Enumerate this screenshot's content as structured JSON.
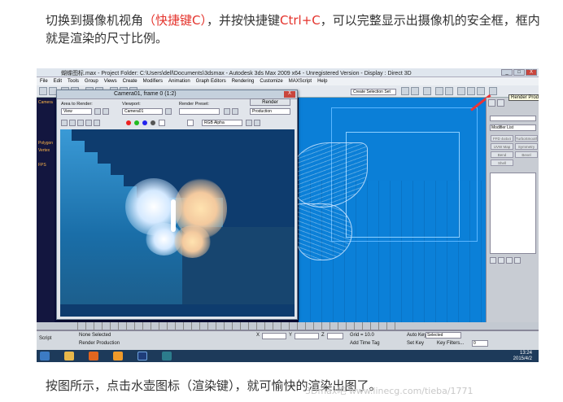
{
  "caption_top": {
    "part1": "切换到摄像机视角",
    "highlight1": "（快捷键C）",
    "part2": "，并按快捷键",
    "highlight2": "Ctrl+C",
    "part3": "，可以完整显示出摄像机的安全框，框内就是渲染的尺寸比例。"
  },
  "caption_bottom": "按图所示，点击水壶图标（渲染键），就可愉快的渲染出图了。",
  "watermark": "3Dmax吧 www.linecg.com/tieba/1771",
  "app": {
    "title": "蝴蝶图标.max    - Project Folder: C:\\Users\\dell\\Documents\\3dsmax    - Autodesk 3ds Max  2009 x64   - Unregistered Version    - Display : Direct 3D",
    "menus": [
      "File",
      "Edit",
      "Tools",
      "Group",
      "Views",
      "Create",
      "Modifiers",
      "Animation",
      "Graph Editors",
      "Rendering",
      "Customize",
      "MAXScript",
      "Help"
    ],
    "selection_set": "Create Selection Set",
    "left_labels": [
      "Camera",
      "Polygon",
      "Vertex",
      "FPS"
    ],
    "win_buttons": [
      "_",
      "□",
      "X"
    ]
  },
  "camera_window": {
    "title": "Camera01, frame 0 (1:2)",
    "area_label": "Area to Render:",
    "area_value": "View",
    "viewport_label": "Viewport:",
    "viewport_value": "Camera01",
    "preset_label": "Render Preset:",
    "preset_value": "",
    "render_button": "Render",
    "production_value": "Production",
    "channel_value": "RGB Alpha",
    "close": "X"
  },
  "command_panel": {
    "tooltip": "Render Production",
    "modifier_list": "Modifier List",
    "modifier_buttons": [
      "FFD 4x4x4",
      "TurboSmooth",
      "UVW Map",
      "Symmetry",
      "Bend",
      "Bevel",
      "Shell"
    ]
  },
  "status": {
    "selection": "None Selected",
    "prompt": "Render Production",
    "x_label": "X",
    "y_label": "Y",
    "z_label": "Z",
    "grid": "Grid = 10.0",
    "add_time_tag": "Add Time Tag",
    "auto_key": "Auto Key",
    "auto_key_value": "Selected",
    "set_key": "Set Key",
    "key_filters": "Key Filters...",
    "frame": "0",
    "script": "Script",
    "timeline_ticks": [
      "0",
      "5",
      "10",
      "15",
      "20",
      "25",
      "30",
      "35",
      "40",
      "45",
      "50",
      "55",
      "60",
      "65",
      "70",
      "75",
      "80",
      "85",
      "90",
      "95",
      "100"
    ]
  },
  "taskbar": {
    "time": "13:24",
    "date": "2015/4/2",
    "apps": [
      "start",
      "explorer",
      "firefox",
      "media",
      "photoshop",
      "3dsmax"
    ]
  },
  "colors": {
    "highlight": "#e4322b",
    "viewport_blue": "#0b7fd7",
    "render_frame_red": "#e33333"
  }
}
